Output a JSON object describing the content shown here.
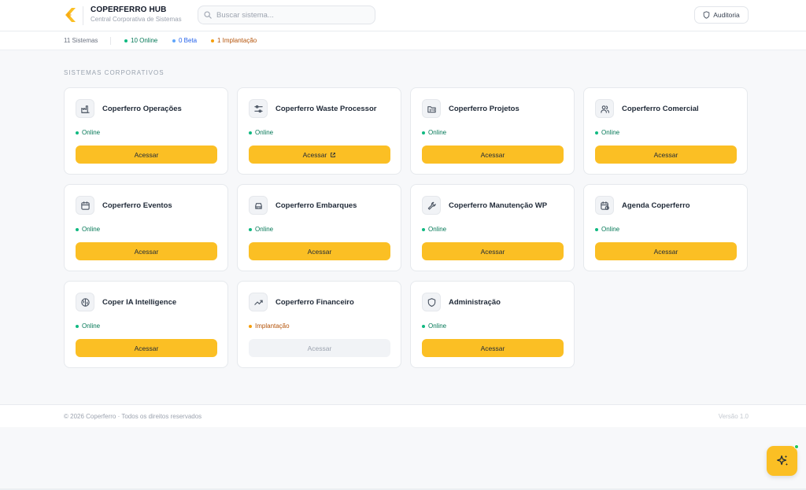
{
  "header": {
    "brand_title": "COPERFERRO HUB",
    "brand_subtitle": "Central Corporativa de Sistemas",
    "search_placeholder": "Buscar sistema...",
    "search_value": "",
    "audit_label": "Auditoria"
  },
  "stats": {
    "total": "11 Sistemas",
    "online": "10 Online",
    "beta": "0 Beta",
    "implantacao": "1 Implantação"
  },
  "section": {
    "title": "SISTEMAS CORPORATIVOS"
  },
  "colors": {
    "accent": "#fbbf24",
    "online": "#10b981",
    "online_text": "#047857",
    "beta": "#60a5fa",
    "implantacao": "#f59e0b",
    "implantacao_text": "#b45309"
  },
  "cards": [
    {
      "name": "Coperferro Operações",
      "status": "Online",
      "status_key": "online",
      "action": "Acessar",
      "icon": "factory-icon",
      "external": false,
      "disabled": false
    },
    {
      "name": "Coperferro Waste Processor",
      "status": "Online",
      "status_key": "online",
      "action": "Acessar",
      "icon": "sliders-icon",
      "external": true,
      "disabled": false
    },
    {
      "name": "Coperferro Projetos",
      "status": "Online",
      "status_key": "online",
      "action": "Acessar",
      "icon": "folder-kanban-icon",
      "external": false,
      "disabled": false
    },
    {
      "name": "Coperferro Comercial",
      "status": "Online",
      "status_key": "online",
      "action": "Acessar",
      "icon": "users-icon",
      "external": false,
      "disabled": false
    },
    {
      "name": "Coperferro Eventos",
      "status": "Online",
      "status_key": "online",
      "action": "Acessar",
      "icon": "calendar-icon",
      "external": false,
      "disabled": false
    },
    {
      "name": "Coperferro Embarques",
      "status": "Online",
      "status_key": "online",
      "action": "Acessar",
      "icon": "truck-icon",
      "external": false,
      "disabled": false
    },
    {
      "name": "Coperferro Manutenção WP",
      "status": "Online",
      "status_key": "online",
      "action": "Acessar",
      "icon": "wrench-icon",
      "external": false,
      "disabled": false
    },
    {
      "name": "Agenda Coperferro",
      "status": "Online",
      "status_key": "online",
      "action": "Acessar",
      "icon": "calendar-clock-icon",
      "external": false,
      "disabled": false
    },
    {
      "name": "Coper IA Intelligence",
      "status": "Online",
      "status_key": "online",
      "action": "Acessar",
      "icon": "brain-icon",
      "external": false,
      "disabled": false
    },
    {
      "name": "Coperferro Financeiro",
      "status": "Implantação",
      "status_key": "implantacao",
      "action": "Acessar",
      "icon": "trending-up-icon",
      "external": false,
      "disabled": true
    },
    {
      "name": "Administração",
      "status": "Online",
      "status_key": "online",
      "action": "Acessar",
      "icon": "shield-icon",
      "external": false,
      "disabled": false
    }
  ],
  "footer": {
    "copyright": "© 2026 Coperferro · Todos os direitos reservados",
    "version": "Versão 1.0"
  }
}
